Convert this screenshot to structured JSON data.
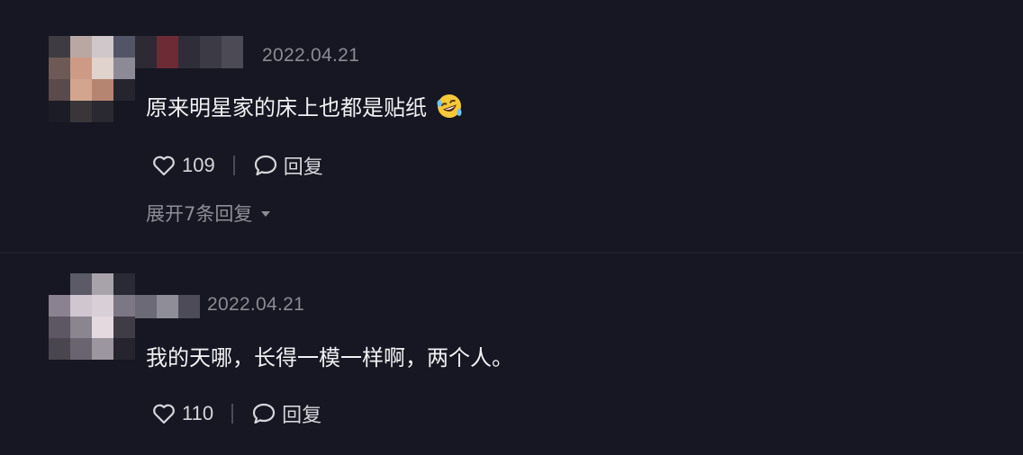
{
  "comments": [
    {
      "date": "2022.04.21",
      "text": "原来明星家的床上也都是贴纸",
      "emoji": "rofl-emoji",
      "likes": "109",
      "reply_label": "回复",
      "expand_label": "展开7条回复"
    },
    {
      "date": "2022.04.21",
      "text": "我的天哪，长得一模一样啊，两个人。",
      "likes": "110",
      "reply_label": "回复"
    }
  ],
  "icons": {
    "like": "heart-outline-icon",
    "reply": "speech-bubble-icon",
    "expand": "caret-down-icon"
  },
  "colors": {
    "background": "#161722",
    "text": "#f1f1f3",
    "muted": "#8a8b93"
  }
}
